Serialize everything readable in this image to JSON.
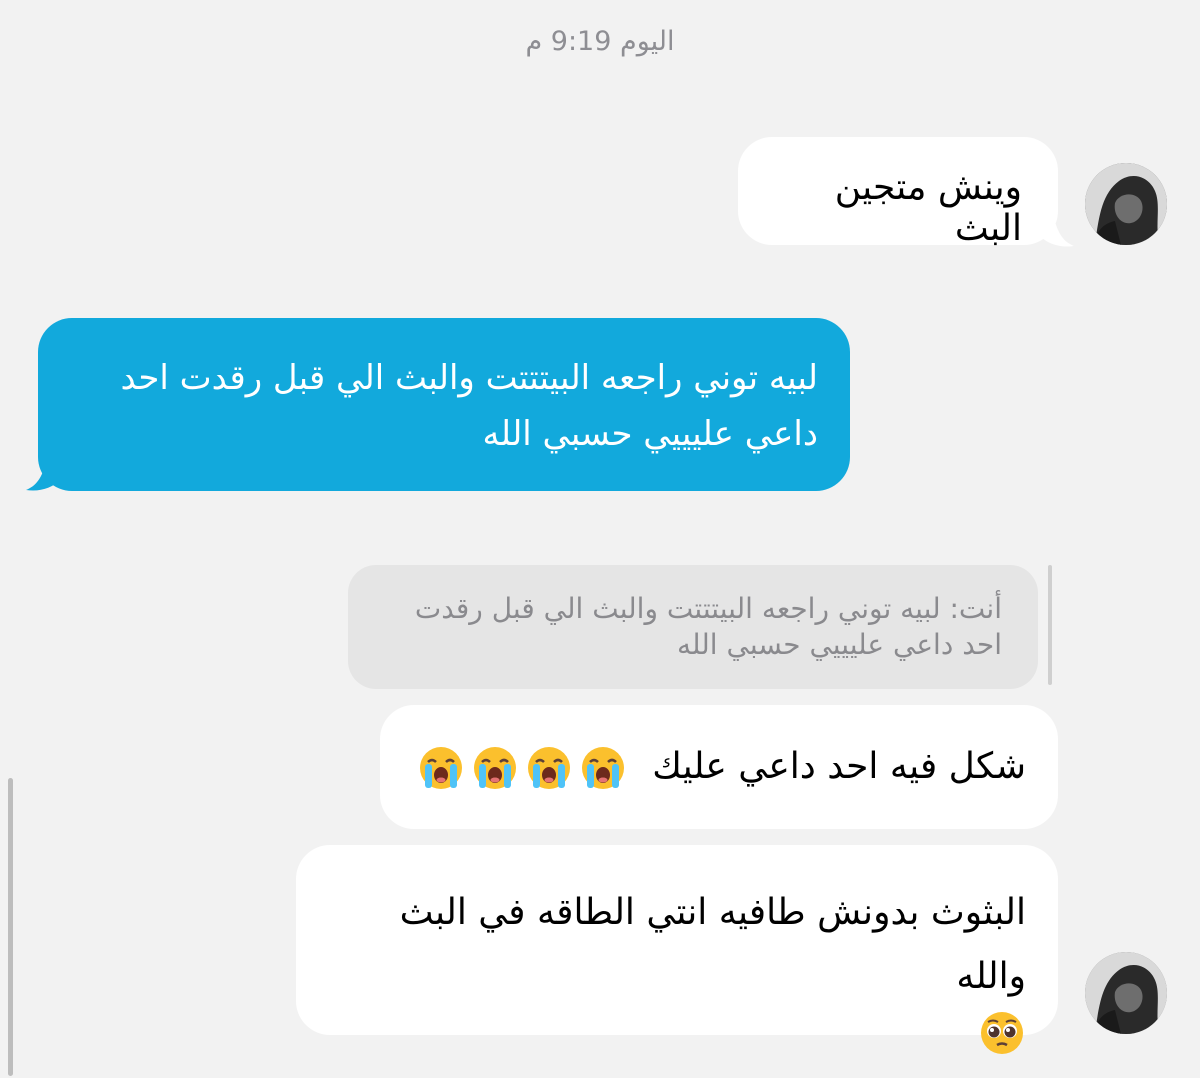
{
  "chat": {
    "timestamp": "اليوم 9:19 م",
    "messages": [
      {
        "sender": "them",
        "text": "وينش متجين البث",
        "avatar": "profile-photo"
      },
      {
        "sender": "me",
        "text_line1": "لبيه توني راجعه البيتتتت والبث الي قبل رقدت احد",
        "text_line2": "داعي عليييي حسبي الله"
      },
      {
        "sender": "them",
        "reply_line1": "أنت: لبيه توني راجعه البيتتتت والبث الي قبل رقدت",
        "reply_line2": "احد داعي عليييي حسبي الله",
        "text": "شكل فيه احد داعي عليك",
        "emojis": [
          "loudly-crying-face",
          "loudly-crying-face",
          "loudly-crying-face",
          "loudly-crying-face"
        ]
      },
      {
        "sender": "them",
        "text_line1": "البثوث بدونش طافيه انتي الطاقه في البث والله",
        "emoji": "pleading-face",
        "avatar": "profile-photo"
      }
    ]
  },
  "colors": {
    "background": "#f2f2f2",
    "incoming_bubble": "#ffffff",
    "outgoing_bubble": "#12a9dc",
    "reply_quote": "#e5e5e5",
    "timestamp": "#8e8e93"
  }
}
